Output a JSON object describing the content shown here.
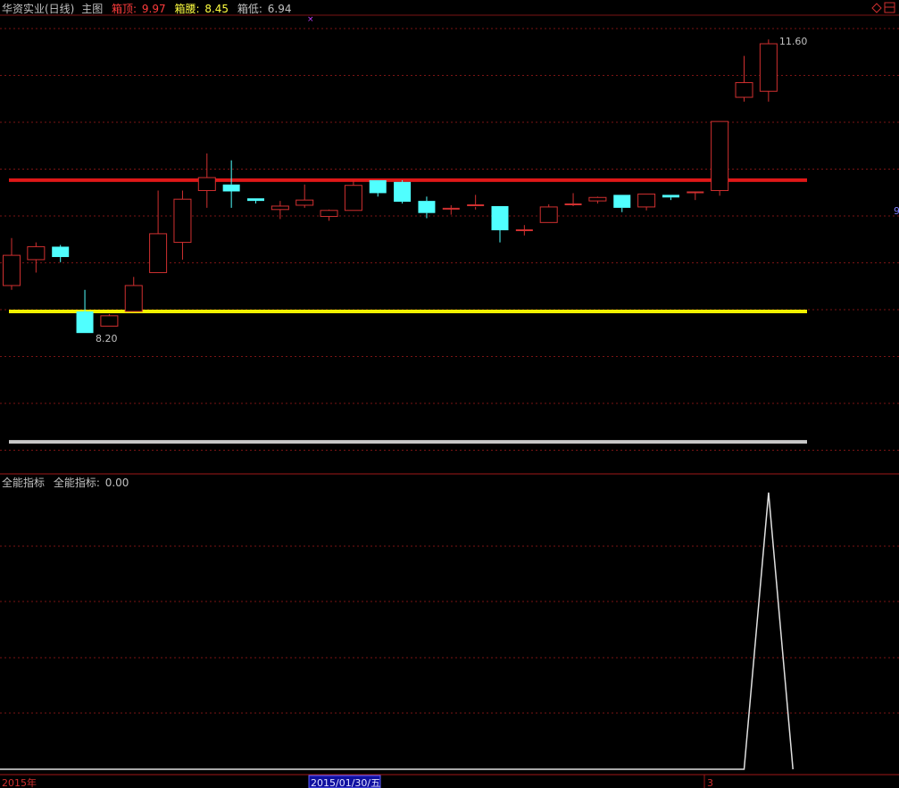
{
  "header": {
    "stock_name": "华资实业(日线)",
    "chart_label": "主图",
    "box_top_label": "箱顶:",
    "box_top_value": "9.97",
    "box_mid_label": "箱腰:",
    "box_mid_value": "8.45",
    "box_low_label": "箱低:",
    "box_low_value": "6.94"
  },
  "colors": {
    "up": "#d03030",
    "down": "#50ffff",
    "box_top_line": "#e01818",
    "box_mid_line": "#f0f000",
    "box_low_line": "#c8c8c8",
    "grid": "#7a1414",
    "label_red": "#ff3c3c",
    "label_yellow": "#ffff40",
    "indicator_line": "#e0e0e0"
  },
  "chart_data": [
    {
      "type": "candlestick",
      "title": "华资实业(日线)",
      "ylim": [
        6.6,
        11.85
      ],
      "x": [
        "d01",
        "d02",
        "d03",
        "d04",
        "d05",
        "d06",
        "d07",
        "d08",
        "d09",
        "d10",
        "d11",
        "d12",
        "d13",
        "d14",
        "d15",
        "d16",
        "d17",
        "d18",
        "d19",
        "d20",
        "d21",
        "d22",
        "d23",
        "d24",
        "d25",
        "d26",
        "d27",
        "d28",
        "d29",
        "d30",
        "d31",
        "d32",
        "d33"
      ],
      "candles": [
        {
          "o": 8.75,
          "h": 9.3,
          "l": 8.7,
          "c": 9.1
        },
        {
          "o": 9.05,
          "h": 9.25,
          "l": 8.9,
          "c": 9.2
        },
        {
          "o": 9.2,
          "h": 9.22,
          "l": 9.02,
          "c": 9.08
        },
        {
          "o": 8.45,
          "h": 8.7,
          "l": 8.2,
          "c": 8.2
        },
        {
          "o": 8.28,
          "h": 8.42,
          "l": 8.28,
          "c": 8.4
        },
        {
          "o": 8.45,
          "h": 8.85,
          "l": 8.45,
          "c": 8.75
        },
        {
          "o": 8.9,
          "h": 9.85,
          "l": 8.9,
          "c": 9.35
        },
        {
          "o": 9.25,
          "h": 9.85,
          "l": 9.05,
          "c": 9.75
        },
        {
          "o": 9.85,
          "h": 10.28,
          "l": 9.65,
          "c": 10.0
        },
        {
          "o": 9.92,
          "h": 10.2,
          "l": 9.65,
          "c": 9.84
        },
        {
          "o": 9.76,
          "h": 9.76,
          "l": 9.7,
          "c": 9.73
        },
        {
          "o": 9.63,
          "h": 9.73,
          "l": 9.52,
          "c": 9.67
        },
        {
          "o": 9.68,
          "h": 9.92,
          "l": 9.65,
          "c": 9.74
        },
        {
          "o": 9.55,
          "h": 9.63,
          "l": 9.5,
          "c": 9.62
        },
        {
          "o": 9.62,
          "h": 9.97,
          "l": 9.62,
          "c": 9.91
        },
        {
          "o": 9.97,
          "h": 9.97,
          "l": 9.78,
          "c": 9.82
        },
        {
          "o": 9.95,
          "h": 9.97,
          "l": 9.7,
          "c": 9.72
        },
        {
          "o": 9.73,
          "h": 9.78,
          "l": 9.53,
          "c": 9.59
        },
        {
          "o": 9.64,
          "h": 9.68,
          "l": 9.57,
          "c": 9.64
        },
        {
          "o": 9.66,
          "h": 9.8,
          "l": 9.63,
          "c": 9.68
        },
        {
          "o": 9.67,
          "h": 9.67,
          "l": 9.25,
          "c": 9.39
        },
        {
          "o": 9.39,
          "h": 9.45,
          "l": 9.33,
          "c": 9.39
        },
        {
          "o": 9.48,
          "h": 9.69,
          "l": 9.48,
          "c": 9.66
        },
        {
          "o": 9.68,
          "h": 9.82,
          "l": 9.67,
          "c": 9.69
        },
        {
          "o": 9.73,
          "h": 9.78,
          "l": 9.7,
          "c": 9.77
        },
        {
          "o": 9.8,
          "h": 9.8,
          "l": 9.6,
          "c": 9.65
        },
        {
          "o": 9.66,
          "h": 9.81,
          "l": 9.62,
          "c": 9.81
        },
        {
          "o": 9.8,
          "h": 9.8,
          "l": 9.74,
          "c": 9.77
        },
        {
          "o": 9.82,
          "h": 9.84,
          "l": 9.74,
          "c": 9.83
        },
        {
          "o": 9.85,
          "h": 10.65,
          "l": 9.79,
          "c": 10.65
        },
        {
          "o": 10.93,
          "h": 11.41,
          "l": 10.88,
          "c": 11.1
        },
        {
          "o": 11.0,
          "h": 11.6,
          "l": 10.88,
          "c": 11.55
        },
        {
          "o": 11.55,
          "h": 11.55,
          "l": 11.55,
          "c": 11.55
        }
      ],
      "box_lines": {
        "top": 9.97,
        "mid": 8.45,
        "low": 6.94
      },
      "annotations": [
        {
          "label": "8.20",
          "candle": 3,
          "price": 8.2
        },
        {
          "label": "11.60",
          "candle": 31,
          "price": 11.6
        }
      ]
    },
    {
      "type": "line",
      "title": "全能指标",
      "legend_label": "全能指标:",
      "legend_value": "0.00",
      "series": [
        {
          "values": [
            0,
            0,
            0,
            0,
            0,
            0,
            0,
            0,
            0,
            0,
            0,
            0,
            0,
            0,
            0,
            0,
            0,
            0,
            0,
            0,
            0,
            0,
            0,
            0,
            0,
            0,
            0,
            0,
            0,
            0,
            0,
            1,
            0
          ]
        }
      ]
    }
  ],
  "axis": {
    "year_label": "2015年",
    "cursor_date": "2015/01/30/五",
    "tick_label": "3",
    "right_mark": "9"
  }
}
